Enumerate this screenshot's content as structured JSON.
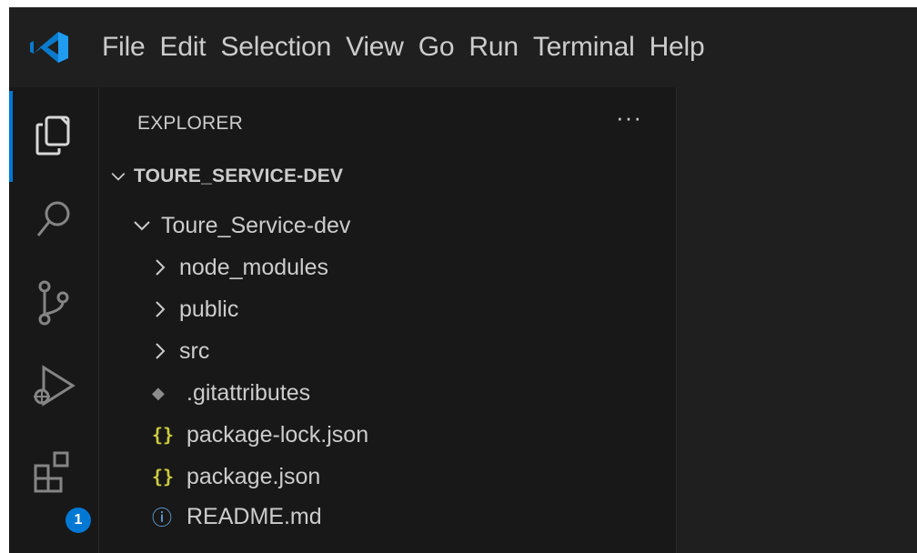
{
  "menu": [
    "File",
    "Edit",
    "Selection",
    "View",
    "Go",
    "Run",
    "Terminal",
    "Help"
  ],
  "activity_bar": {
    "items": [
      "explorer-icon",
      "search-icon",
      "source-control-icon",
      "run-debug-icon",
      "extensions-icon"
    ],
    "extensions_badge": "1",
    "active_color": "#0078d4"
  },
  "sidebar": {
    "title": "EXPLORER",
    "more_actions": "···",
    "section": "TOURE_SERVICE-DEV",
    "tree": [
      {
        "label": "Toure_Service-dev",
        "kind": "folder-open"
      },
      {
        "label": "node_modules",
        "kind": "folder"
      },
      {
        "label": "public",
        "kind": "folder"
      },
      {
        "label": "src",
        "kind": "folder"
      },
      {
        "label": ".gitattributes",
        "kind": "git-file",
        "icon": "◆"
      },
      {
        "label": "package-lock.json",
        "kind": "json-file",
        "icon": "{}"
      },
      {
        "label": "package.json",
        "kind": "json-file",
        "icon": "{}"
      },
      {
        "label": "README.md",
        "kind": "info-file",
        "icon": "ⓘ"
      }
    ]
  },
  "colors": {
    "background": "#181818",
    "menubar": "#1f1f1f",
    "text": "#cccccc",
    "json_icon": "#cbcb41",
    "info_icon": "#6fb3f5",
    "accent": "#0078d4"
  }
}
